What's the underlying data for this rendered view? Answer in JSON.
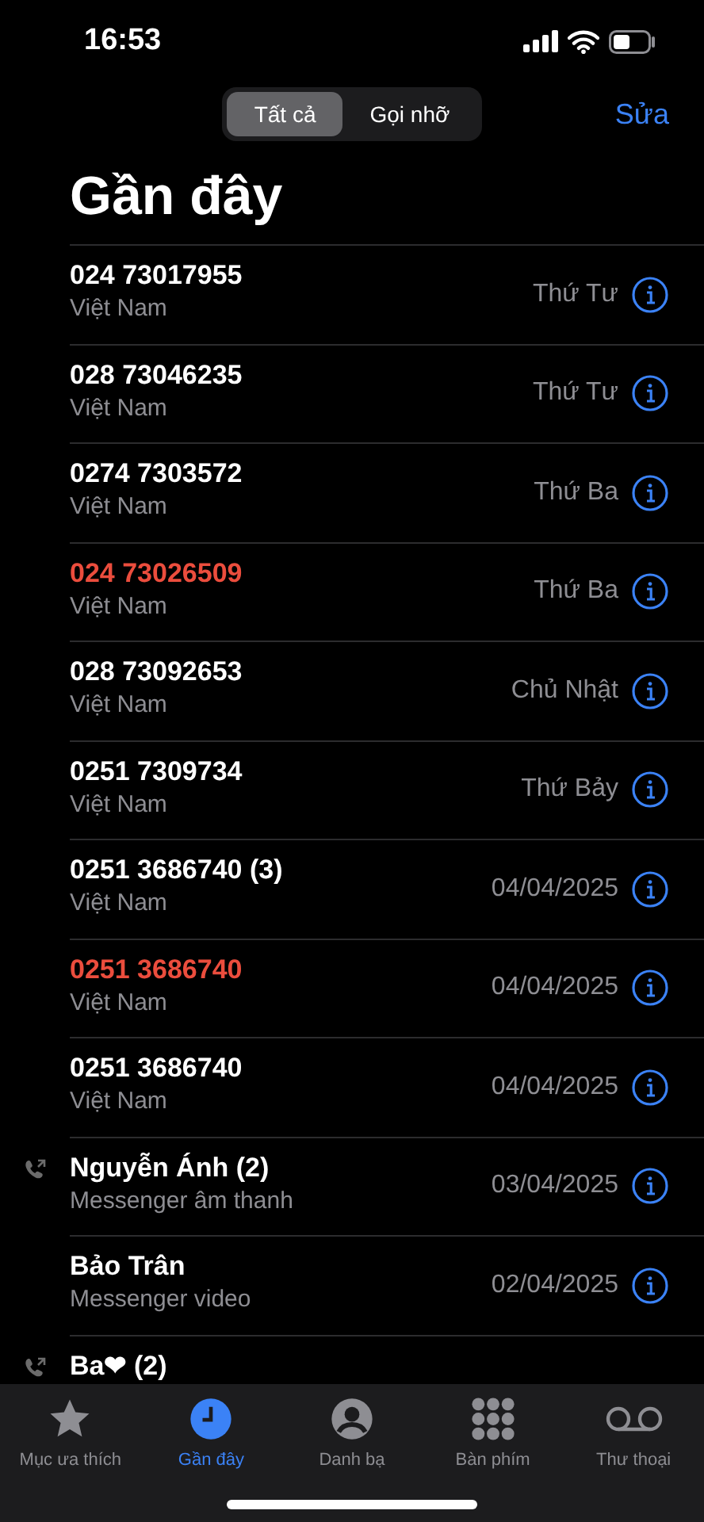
{
  "status_bar": {
    "time": "16:53"
  },
  "segments": [
    {
      "label": "Tất cả",
      "selected": true
    },
    {
      "label": "Gọi nhỡ",
      "selected": false
    }
  ],
  "edit_button": "Sửa",
  "title": "Gần đây",
  "calls": [
    {
      "name": "024 73017955",
      "detail": "Việt Nam",
      "date": "Thứ Tư",
      "missed": false,
      "outgoing": false
    },
    {
      "name": "028 73046235",
      "detail": "Việt Nam",
      "date": "Thứ Tư",
      "missed": false,
      "outgoing": false
    },
    {
      "name": "0274 7303572",
      "detail": "Việt Nam",
      "date": "Thứ Ba",
      "missed": false,
      "outgoing": false
    },
    {
      "name": "024 73026509",
      "detail": "Việt Nam",
      "date": "Thứ Ba",
      "missed": true,
      "outgoing": false
    },
    {
      "name": "028 73092653",
      "detail": "Việt Nam",
      "date": "Chủ Nhật",
      "missed": false,
      "outgoing": false
    },
    {
      "name": "0251 7309734",
      "detail": "Việt Nam",
      "date": "Thứ Bảy",
      "missed": false,
      "outgoing": false
    },
    {
      "name": "0251 3686740 (3)",
      "detail": "Việt Nam",
      "date": "04/04/2025",
      "missed": false,
      "outgoing": false
    },
    {
      "name": "0251 3686740",
      "detail": "Việt Nam",
      "date": "04/04/2025",
      "missed": true,
      "outgoing": false
    },
    {
      "name": "0251 3686740",
      "detail": "Việt Nam",
      "date": "04/04/2025",
      "missed": false,
      "outgoing": false
    },
    {
      "name": "Nguyễn Ánh (2)",
      "detail": "Messenger âm thanh",
      "date": "03/04/2025",
      "missed": false,
      "outgoing": true
    },
    {
      "name": "Bảo Trân",
      "detail": "Messenger video",
      "date": "02/04/2025",
      "missed": false,
      "outgoing": false
    },
    {
      "name": "Ba❤ (2)",
      "missed": false,
      "outgoing": true
    }
  ],
  "tab_bar": [
    {
      "label": "Mục ưa thích",
      "kind": "star",
      "selected": false
    },
    {
      "label": "Gần đây",
      "kind": "clock",
      "selected": true
    },
    {
      "label": "Danh bạ",
      "kind": "person",
      "selected": false
    },
    {
      "label": "Bàn phím",
      "kind": "keypad",
      "selected": false
    },
    {
      "label": "Thư thoại",
      "kind": "voicemail",
      "selected": false
    }
  ]
}
